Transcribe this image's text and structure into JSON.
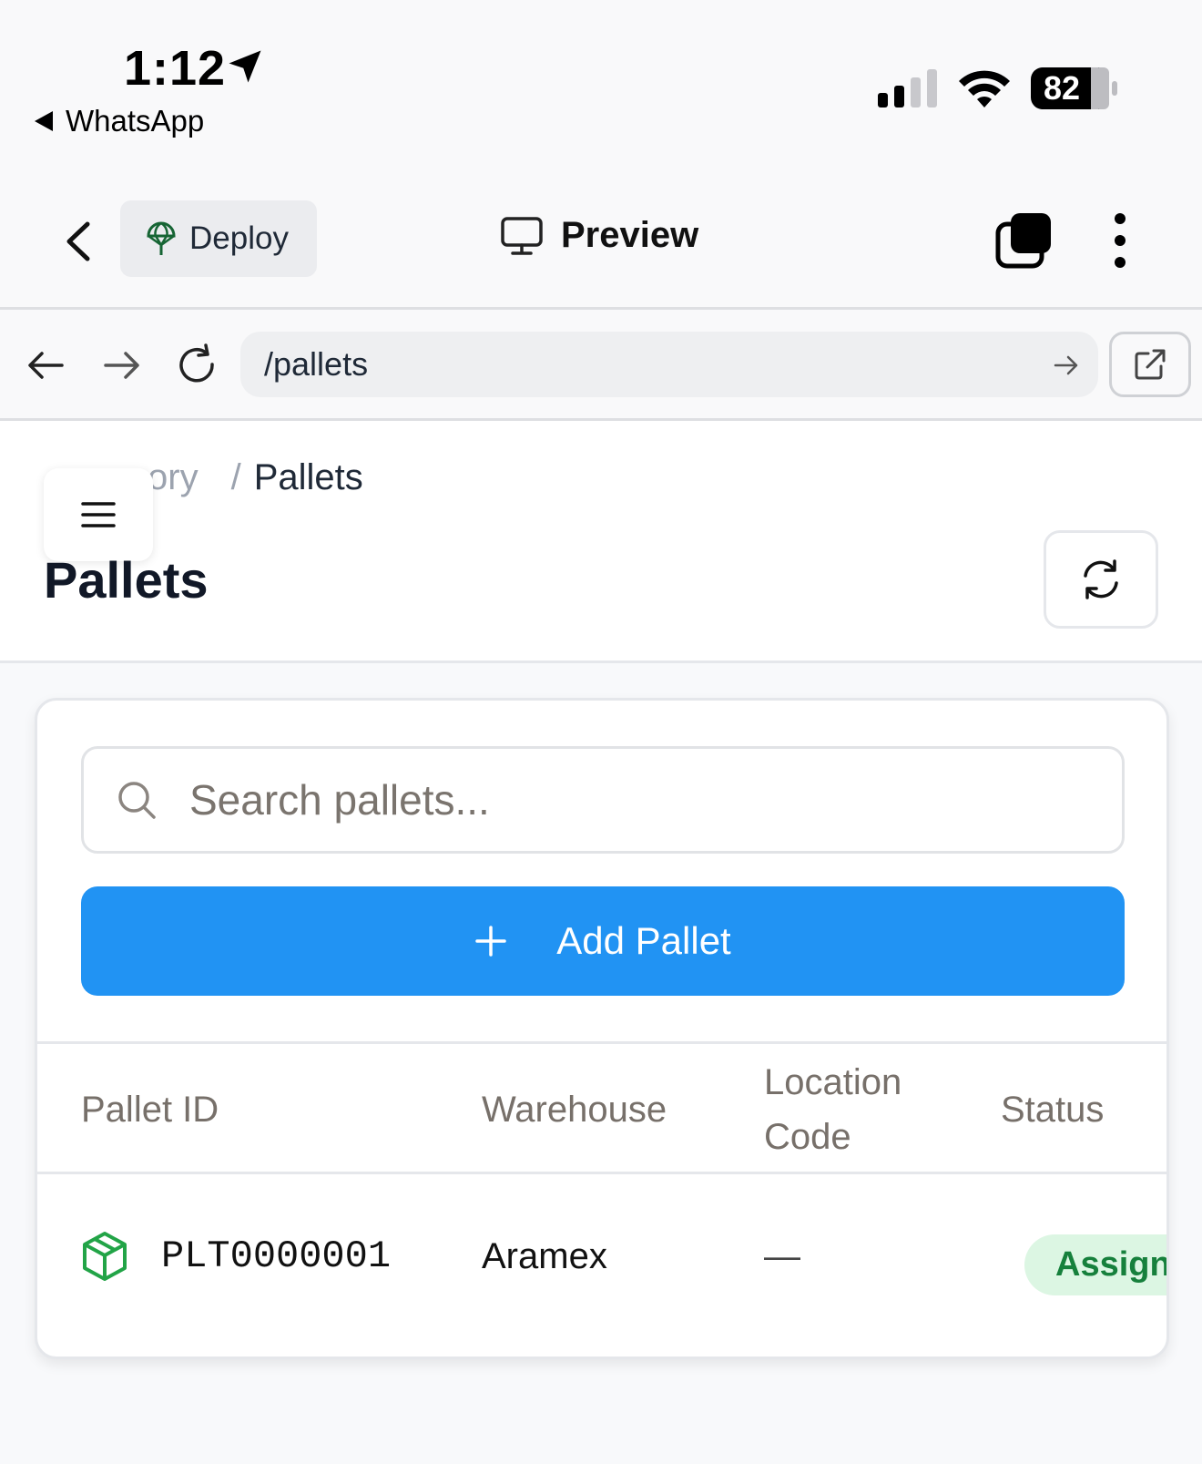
{
  "status_bar": {
    "time": "1:12",
    "back_app": "WhatsApp",
    "battery": "82"
  },
  "app_header": {
    "deploy_label": "Deploy",
    "preview_label": "Preview"
  },
  "browser": {
    "url": "/pallets"
  },
  "breadcrumb": {
    "parent": "ory",
    "separator": "/",
    "current": "Pallets"
  },
  "page": {
    "title": "Pallets"
  },
  "search": {
    "placeholder": "Search pallets..."
  },
  "actions": {
    "add_label": "Add Pallet"
  },
  "table": {
    "headers": {
      "pallet_id": "Pallet ID",
      "warehouse": "Warehouse",
      "location_line1": "Location",
      "location_line2": "Code",
      "status": "Status"
    },
    "rows": [
      {
        "pallet_id": "PLT0000001",
        "warehouse": "Aramex",
        "location_code": "—",
        "status": "Assigned"
      }
    ]
  },
  "colors": {
    "primary": "#2193f3",
    "status_bg": "#dcf6e3",
    "status_text": "#16803c",
    "box_icon": "#22a447"
  }
}
